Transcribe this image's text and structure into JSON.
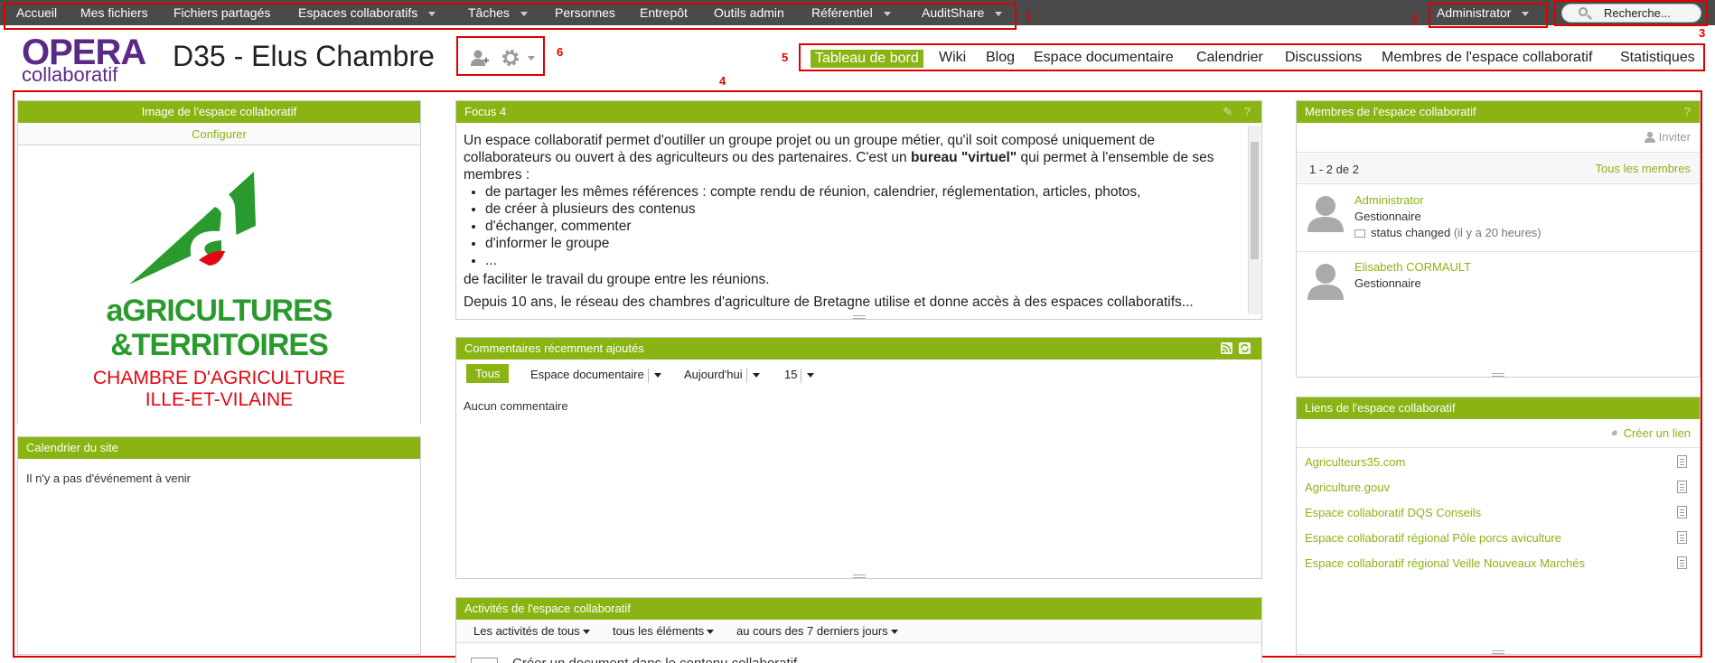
{
  "topnav": {
    "items": [
      "Accueil",
      "Mes fichiers",
      "Fichiers partagés",
      "Espaces collaboratifs",
      "Tâches",
      "Personnes",
      "Entrepôt",
      "Outils admin",
      "Référentiel",
      "AuditShare"
    ],
    "user": "Administrator",
    "search_placeholder": "Recherche..."
  },
  "annotations": [
    "1",
    "2",
    "3",
    "4",
    "5",
    "6"
  ],
  "logo": {
    "line1": "OPERA",
    "line2": "collaboratif"
  },
  "site": {
    "title": "D35 - Elus Chambre"
  },
  "site_tabs": [
    "Tableau de bord",
    "Wiki",
    "Blog",
    "Espace documentaire",
    "Calendrier",
    "Discussions",
    "Membres de l'espace collaboratif",
    "Statistiques"
  ],
  "image_panel": {
    "title": "Image de l'espace collaboratif",
    "configure": "Configurer",
    "brand_line1": "aGRICULTURES",
    "brand_line2": "&TERRITOIRES",
    "brand_line3": "CHAMBRE D'AGRICULTURE",
    "brand_line4": "ILLE-ET-VILAINE"
  },
  "calendar_panel": {
    "title": "Calendrier du site",
    "empty": "Il n'y a pas d'événement à venir"
  },
  "focus_panel": {
    "title": "Focus 4",
    "para1_a": "Un  espace collaboratif permet d'outiller un groupe projet ou un groupe métier, qu'il soit composé uniquement de collaborateurs ou ouvert à des agriculteurs ou des partenaires. C'est un ",
    "para1_bold": "bureau \"virtuel\"",
    "para1_b": " qui  permet à l'ensemble de ses membres :",
    "bullets": [
      "de partager les mêmes références : compte rendu de réunion, calendrier, réglementation, articles, photos,",
      "de créer à plusieurs des contenus",
      "d'échanger, commenter",
      "d'informer le groupe",
      "..."
    ],
    "para2": "de faciliter le travail du groupe entre les réunions.",
    "para3": "Depuis 10 ans, le réseau des chambres d'agriculture de Bretagne utilise et donne accès à des espaces collaboratifs..."
  },
  "comments_panel": {
    "title": "Commentaires récemment ajoutés",
    "filter_all": "Tous",
    "filter_source": "Espace documentaire",
    "filter_date": "Aujourd'hui",
    "filter_count": "15",
    "empty": "Aucun commentaire"
  },
  "activities_panel": {
    "title": "Activités de l'espace collaboratif",
    "filter_who": "Les activités de tous",
    "filter_what": "tous les éléments",
    "filter_when": "au cours des 7 derniers jours",
    "partial_row": "Créer un document dans le contenu collaboratif"
  },
  "members_panel": {
    "title": "Membres de l'espace collaboratif",
    "invite": "Inviter",
    "count": "1 - 2 de 2",
    "all_members": "Tous les membres",
    "members": [
      {
        "name": "Administrator",
        "role": "Gestionnaire",
        "status": "status changed",
        "status_time": "(il y a 20 heures)"
      },
      {
        "name": "Elisabeth CORMAULT",
        "role": "Gestionnaire"
      }
    ]
  },
  "links_panel": {
    "title": "Liens de l'espace collaboratif",
    "create": "Créer un lien",
    "links": [
      "Agriculteurs35.com",
      "Agriculture.gouv",
      "Espace collaboratif DQS Conseils",
      "Espace collaboratif régional Pôle porcs aviculture",
      "Espace collaboratif régional Veille Nouveaux Marchés"
    ]
  },
  "colors": {
    "accent": "#8ab414",
    "topbar": "#4a4a4a",
    "annotation": "#e00000",
    "brand": "#5b2a86"
  },
  "icons": [
    "search-icon",
    "user-add-icon",
    "gear-icon",
    "rss-icon",
    "refresh-icon",
    "edit-icon",
    "help-icon",
    "person-icon",
    "link-icon",
    "document-icon",
    "avatar-icon"
  ]
}
